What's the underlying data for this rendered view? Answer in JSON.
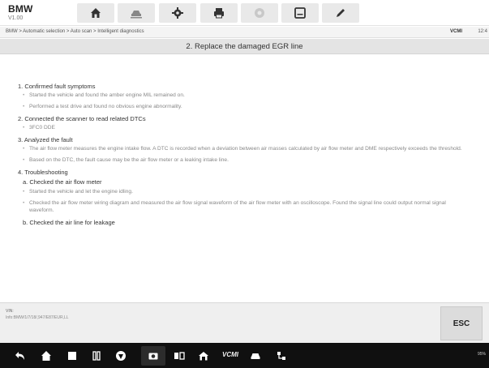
{
  "app": {
    "title": "BMW",
    "version": "V1.00"
  },
  "toolbar": {
    "buttons": [
      "home-icon",
      "car-lift-icon",
      "gear-icon",
      "printer-icon",
      "help-icon",
      "save-icon",
      "pen-icon"
    ]
  },
  "breadcrumb": "BMW > Automatic selection > Auto scan > Intelligent diagnostics",
  "status": {
    "vci": "VCMI",
    "clock": "12:4"
  },
  "page": {
    "title": "2. Replace the damaged EGR line"
  },
  "content": {
    "s1": "1. Confirmed fault symptoms",
    "s1_b1": "Started the vehicle and found the amber engine MIL remained on.",
    "s1_b2": "Performed a test drive and found no obvious engine abnormality.",
    "s2": "2. Connected the scanner to read related DTCs",
    "s2_b1": "3FC0 DDE",
    "s3": "3. Analyzed the fault",
    "s3_b1": "The air flow meter measures the engine intake flow. A DTC is recorded when a deviation between air masses calculated by air flow meter and DME respectively exceeds the threshold.",
    "s3_b2": "Based on the DTC, the fault cause may be the air flow meter or a leaking intake line.",
    "s4": "4. Troubleshooting",
    "s4_a": "a. Checked the air flow meter",
    "s4_a_b1": "Started the vehicle and let the engine idling.",
    "s4_a_b2": "Checked the air flow meter wiring diagram and measured the air flow signal waveform of the air flow meter with an oscilloscope. Found the signal line could output normal signal waveform.",
    "s4_b": "b. Checked the air line for leakage"
  },
  "bottom": {
    "vin_label": "VIN:",
    "info": "Info:BMW/1/7/18/,947/E87/EUR,LL",
    "esc_label": "ESC"
  },
  "navbar": {
    "items": [
      "back-icon",
      "home-icon",
      "recent-apps-icon",
      "square-icon",
      "browser-icon",
      "camera-icon",
      "screen-record-icon",
      "garage-home-icon",
      "vci-icon",
      "car-icon",
      "network-icon"
    ],
    "vcmi_text": "VCMI",
    "status_text": "95%"
  }
}
